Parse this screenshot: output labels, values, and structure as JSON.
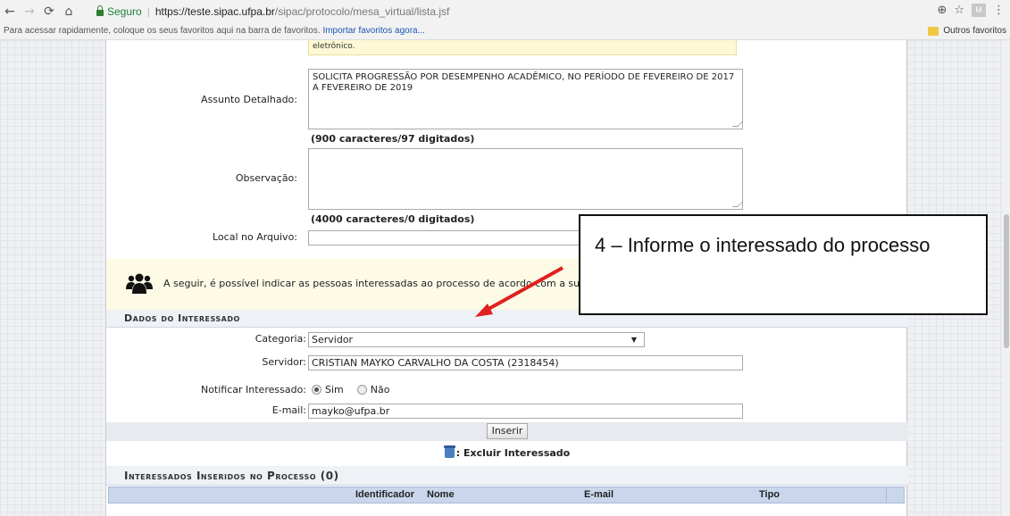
{
  "browser": {
    "secure_label": "Seguro",
    "url_host": "https://teste.sipac.ufpa.br",
    "url_path": "/sipac/protocolo/mesa_virtual/lista.jsf",
    "bookmarks_text": "Para acessar rapidamente, coloque os seus favoritos aqui na barra de favoritos.",
    "bookmarks_link": "Importar favoritos agora...",
    "other_bookmarks": "Outros favoritos",
    "extension_label": "M"
  },
  "form": {
    "top_note": "eletrônico.",
    "assunto_label": "Assunto Detalhado:",
    "assunto_value": "SOLICITA PROGRESSÃO POR DESEMPENHO ACADÊMICO, NO PERÍODO DE FEVEREIRO DE 2017 A FEVEREIRO DE 2019",
    "assunto_counter": "(900 caracteres/97 digitados)",
    "observacao_label": "Observação:",
    "observacao_value": "",
    "observacao_counter": "(4000 caracteres/0 digitados)",
    "local_label": "Local no Arquivo:",
    "local_value": ""
  },
  "info": {
    "text": "A seguir, é possível indicar as pessoas interessadas ao processo de acordo com a sua cate"
  },
  "interessado": {
    "section_title": "Dados do Interessado",
    "categoria_label": "Categoria:",
    "categoria_value": "Servidor",
    "servidor_label": "Servidor:",
    "servidor_value": "CRISTIAN MAYKO CARVALHO DA COSTA (2318454)",
    "notificar_label": "Notificar Interessado:",
    "sim_label": "Sim",
    "nao_label": "Não",
    "email_label": "E-mail:",
    "email_value": "mayko@ufpa.br",
    "inserir_label": "Inserir",
    "excluir_legend": ": Excluir Interessado"
  },
  "inseridos": {
    "section_title": "Interessados Inseridos no Processo (0)",
    "columns": [
      "Identificador",
      "Nome",
      "E-mail",
      "Tipo"
    ]
  },
  "annotation": {
    "text": "4 – Informe o interessado do processo",
    "arrow_color": "#e02020"
  },
  "icons": {
    "back": "back-arrow-icon",
    "forward": "forward-arrow-icon",
    "reload": "reload-icon",
    "home": "home-icon",
    "zoom": "zoom-icon",
    "star": "star-icon",
    "menu": "menu-icon",
    "people": "people-icon",
    "trash": "trash-icon"
  }
}
